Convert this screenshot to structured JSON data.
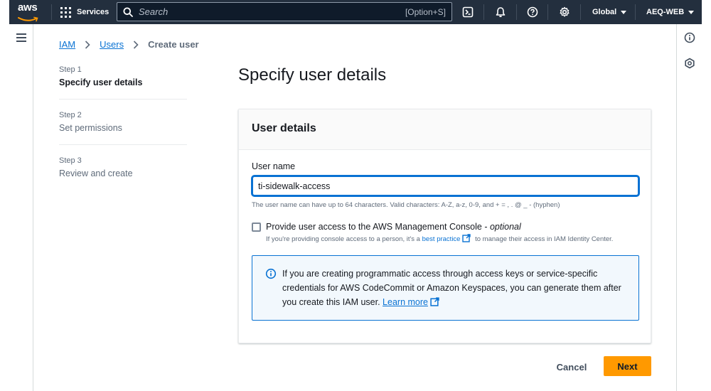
{
  "topnav": {
    "logo_text": "aws",
    "services_label": "Services",
    "search_placeholder": "Search",
    "search_shortcut": "[Option+S]",
    "region_label": "Global",
    "account_label": "AEQ-WEB",
    "icons": [
      "cloudshell-icon",
      "notifications-icon",
      "help-icon",
      "settings-icon"
    ]
  },
  "breadcrumb": {
    "items": [
      "IAM",
      "Users"
    ],
    "current": "Create user"
  },
  "steps": [
    {
      "number": "Step 1",
      "title": "Specify user details",
      "active": true
    },
    {
      "number": "Step 2",
      "title": "Set permissions",
      "active": false
    },
    {
      "number": "Step 3",
      "title": "Review and create",
      "active": false
    }
  ],
  "page": {
    "title": "Specify user details"
  },
  "card": {
    "title": "User details",
    "username_label": "User name",
    "username_value": "ti-sidewalk-access",
    "username_hint": "The user name can have up to 64 characters. Valid characters: A-Z, a-z, 0-9, and + = , . @ _ - (hyphen)",
    "console_checkbox": {
      "label": "Provide user access to the AWS Management Console - ",
      "optional": "optional",
      "checked": false,
      "desc_before": "If you're providing console access to a person, it's a ",
      "desc_link": "best practice",
      "desc_after": " to manage their access in IAM Identity Center."
    },
    "alert": {
      "text": "If you are creating programmatic access through access keys or service-specific credentials for AWS CodeCommit or Amazon Keyspaces, you can generate them after you create this IAM user. ",
      "link": "Learn more"
    }
  },
  "footer": {
    "cancel_label": "Cancel",
    "next_label": "Next"
  },
  "colors": {
    "nav_bg": "#232f3e",
    "link": "#0972d3",
    "primary_button": "#ff9900",
    "alert_bg": "#f2f8fd"
  }
}
